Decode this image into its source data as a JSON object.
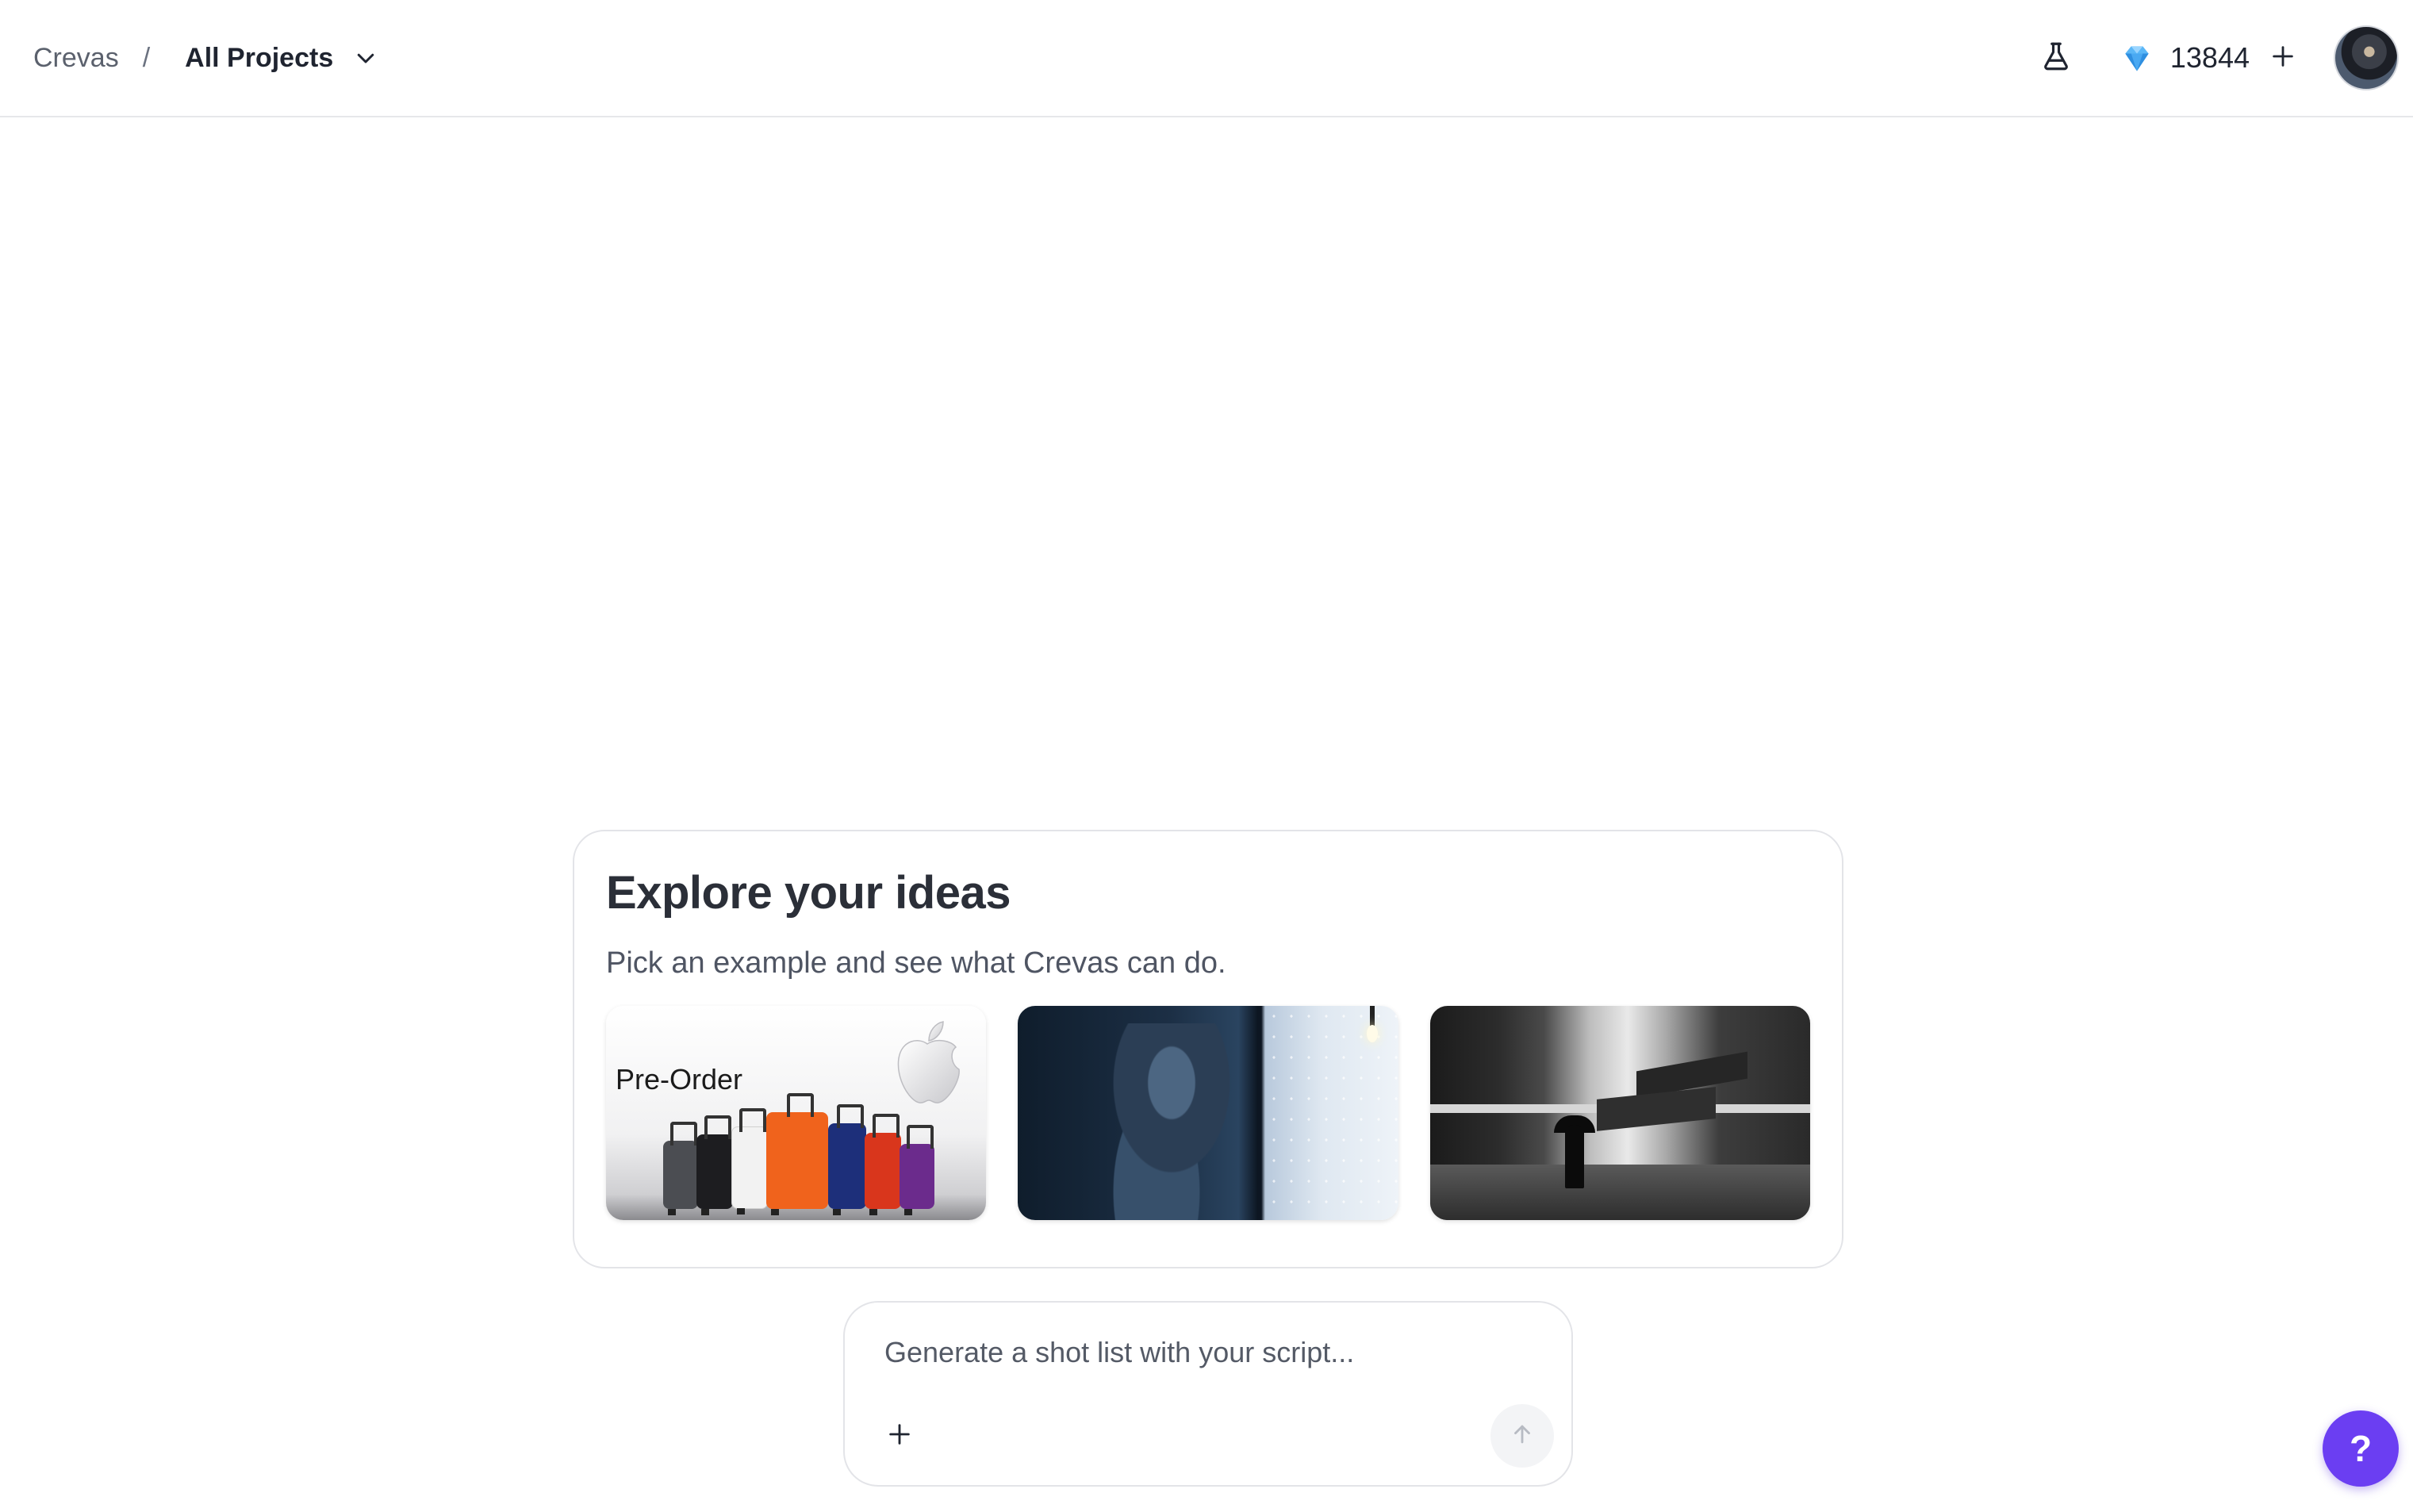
{
  "header": {
    "breadcrumb_root": "Crevas",
    "breadcrumb_separator": "/",
    "project_selector": "All Projects",
    "credits": "13844",
    "icons": {
      "lab": "flask-icon",
      "gem": "diamond-icon",
      "add": "plus-icon",
      "dropdown": "chevron-down-icon"
    }
  },
  "explore": {
    "title": "Explore your ideas",
    "subtitle": "Pick an example and see what Crevas can do.",
    "examples": [
      {
        "label": "Pre-Order",
        "theme": "luggage-product-ad"
      },
      {
        "label": "",
        "theme": "winter-window-scene"
      },
      {
        "label": "",
        "theme": "concrete-architecture-rain"
      }
    ]
  },
  "prompt": {
    "placeholder": "Generate a shot list with your script...",
    "attach_icon": "plus-icon",
    "send_icon": "arrow-up-icon"
  },
  "help": {
    "label": "?"
  },
  "colors": {
    "accent": "#6b3ef2",
    "border": "#e3e4e8",
    "text": "#1f2430",
    "muted": "#545a66",
    "gem": "#3aa0f0"
  }
}
